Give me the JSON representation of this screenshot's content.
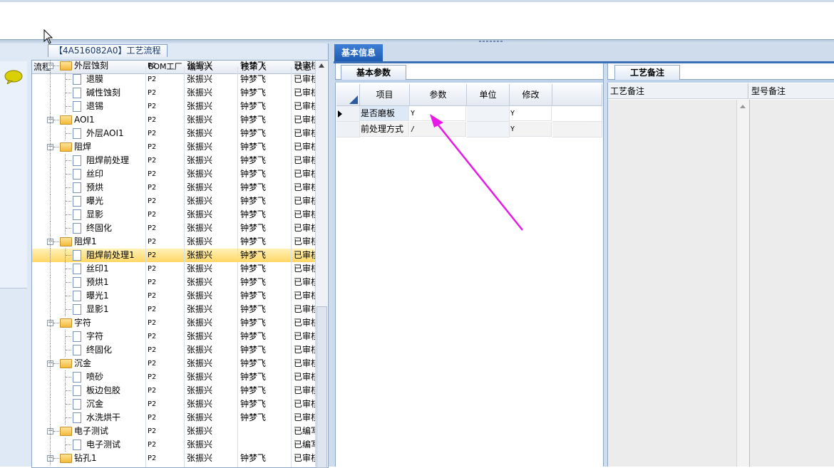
{
  "tree_panel": {
    "title": "【4A516082A0】工艺流程",
    "columns": [
      "流程",
      "BOM工厂",
      "编写人",
      "核审人",
      "状态"
    ],
    "rows": [
      {
        "name": "外层蚀刻",
        "level": 1,
        "type": "folder",
        "bom": "P2",
        "writer": "张振兴",
        "reviewer": "钟梦飞",
        "status": "已审核"
      },
      {
        "name": "退膜",
        "level": 2,
        "type": "doc",
        "bom": "P2",
        "writer": "张振兴",
        "reviewer": "钟梦飞",
        "status": "已审核"
      },
      {
        "name": "碱性蚀刻",
        "level": 2,
        "type": "doc",
        "bom": "P2",
        "writer": "张振兴",
        "reviewer": "钟梦飞",
        "status": "已审核"
      },
      {
        "name": "退锡",
        "level": 2,
        "type": "doc",
        "bom": "P2",
        "writer": "张振兴",
        "reviewer": "钟梦飞",
        "status": "已审核"
      },
      {
        "name": "AOI1",
        "level": 1,
        "type": "folder",
        "bom": "P2",
        "writer": "张振兴",
        "reviewer": "钟梦飞",
        "status": "已审核"
      },
      {
        "name": "外层AOI1",
        "level": 2,
        "type": "doc",
        "bom": "P2",
        "writer": "张振兴",
        "reviewer": "钟梦飞",
        "status": "已审核"
      },
      {
        "name": "阻焊",
        "level": 1,
        "type": "folder",
        "bom": "P2",
        "writer": "张振兴",
        "reviewer": "钟梦飞",
        "status": "已审核"
      },
      {
        "name": "阻焊前处理",
        "level": 2,
        "type": "doc",
        "bom": "P2",
        "writer": "张振兴",
        "reviewer": "钟梦飞",
        "status": "已审核"
      },
      {
        "name": "丝印",
        "level": 2,
        "type": "doc",
        "bom": "P2",
        "writer": "张振兴",
        "reviewer": "钟梦飞",
        "status": "已审核"
      },
      {
        "name": "预烘",
        "level": 2,
        "type": "doc",
        "bom": "P2",
        "writer": "张振兴",
        "reviewer": "钟梦飞",
        "status": "已审核"
      },
      {
        "name": "曝光",
        "level": 2,
        "type": "doc",
        "bom": "P2",
        "writer": "张振兴",
        "reviewer": "钟梦飞",
        "status": "已审核"
      },
      {
        "name": "显影",
        "level": 2,
        "type": "doc",
        "bom": "P2",
        "writer": "张振兴",
        "reviewer": "钟梦飞",
        "status": "已审核"
      },
      {
        "name": "终固化",
        "level": 2,
        "type": "doc",
        "bom": "P2",
        "writer": "张振兴",
        "reviewer": "钟梦飞",
        "status": "已审核"
      },
      {
        "name": "阻焊1",
        "level": 1,
        "type": "folder",
        "bom": "P2",
        "writer": "张振兴",
        "reviewer": "钟梦飞",
        "status": "已审核"
      },
      {
        "name": "阻焊前处理1",
        "level": 2,
        "type": "doc",
        "bom": "P2",
        "writer": "张振兴",
        "reviewer": "钟梦飞",
        "status": "已审核",
        "selected": true
      },
      {
        "name": "丝印1",
        "level": 2,
        "type": "doc",
        "bom": "P2",
        "writer": "张振兴",
        "reviewer": "钟梦飞",
        "status": "已审核"
      },
      {
        "name": "预烘1",
        "level": 2,
        "type": "doc",
        "bom": "P2",
        "writer": "张振兴",
        "reviewer": "钟梦飞",
        "status": "已审核"
      },
      {
        "name": "曝光1",
        "level": 2,
        "type": "doc",
        "bom": "P2",
        "writer": "张振兴",
        "reviewer": "钟梦飞",
        "status": "已审核"
      },
      {
        "name": "显影1",
        "level": 2,
        "type": "doc",
        "bom": "P2",
        "writer": "张振兴",
        "reviewer": "钟梦飞",
        "status": "已审核"
      },
      {
        "name": "字符",
        "level": 1,
        "type": "folder",
        "bom": "P2",
        "writer": "张振兴",
        "reviewer": "钟梦飞",
        "status": "已审核"
      },
      {
        "name": "字符",
        "level": 2,
        "type": "doc",
        "bom": "P2",
        "writer": "张振兴",
        "reviewer": "钟梦飞",
        "status": "已审核"
      },
      {
        "name": "终固化",
        "level": 2,
        "type": "doc",
        "bom": "P2",
        "writer": "张振兴",
        "reviewer": "钟梦飞",
        "status": "已审核"
      },
      {
        "name": "沉金",
        "level": 1,
        "type": "folder",
        "bom": "P2",
        "writer": "张振兴",
        "reviewer": "钟梦飞",
        "status": "已审核"
      },
      {
        "name": "喷砂",
        "level": 2,
        "type": "doc",
        "bom": "P2",
        "writer": "张振兴",
        "reviewer": "钟梦飞",
        "status": "已审核"
      },
      {
        "name": "板边包胶",
        "level": 2,
        "type": "doc",
        "bom": "P2",
        "writer": "张振兴",
        "reviewer": "钟梦飞",
        "status": "已审核"
      },
      {
        "name": "沉金",
        "level": 2,
        "type": "doc",
        "bom": "P2",
        "writer": "张振兴",
        "reviewer": "钟梦飞",
        "status": "已审核"
      },
      {
        "name": "水洗烘干",
        "level": 2,
        "type": "doc",
        "bom": "P2",
        "writer": "张振兴",
        "reviewer": "钟梦飞",
        "status": "已审核"
      },
      {
        "name": "电子测试",
        "level": 1,
        "type": "folder",
        "bom": "P2",
        "writer": "张振兴",
        "reviewer": "",
        "status": "已编写"
      },
      {
        "name": "电子测试",
        "level": 2,
        "type": "doc",
        "bom": "P2",
        "writer": "张振兴",
        "reviewer": "",
        "status": "已编写"
      },
      {
        "name": "钻孔1",
        "level": 1,
        "type": "folder",
        "bom": "P2",
        "writer": "张振兴",
        "reviewer": "钟梦飞",
        "status": "已审核"
      }
    ]
  },
  "right_panel": {
    "main_tab": "基本信息",
    "params_tab": "基本参数",
    "params_columns": [
      "项目",
      "参数",
      "单位",
      "修改"
    ],
    "params_rows": [
      {
        "item": "是否磨板",
        "param": "Y",
        "unit": "",
        "modify": "Y",
        "current": true
      },
      {
        "item": "前处理方式",
        "param": "/",
        "unit": "",
        "modify": "Y",
        "current": false
      }
    ],
    "notes_tab": "工艺备注",
    "notes_col1": "工艺备注",
    "notes_col2": "型号备注"
  },
  "colors": {
    "accent_tab": "#1e5cb3",
    "selection": "#ffd766",
    "annotation_arrow": "#e619e6"
  },
  "icons": [
    "chat-bubble-icon",
    "folder-icon",
    "document-icon",
    "mouse-cursor-icon",
    "annotation-arrow"
  ]
}
